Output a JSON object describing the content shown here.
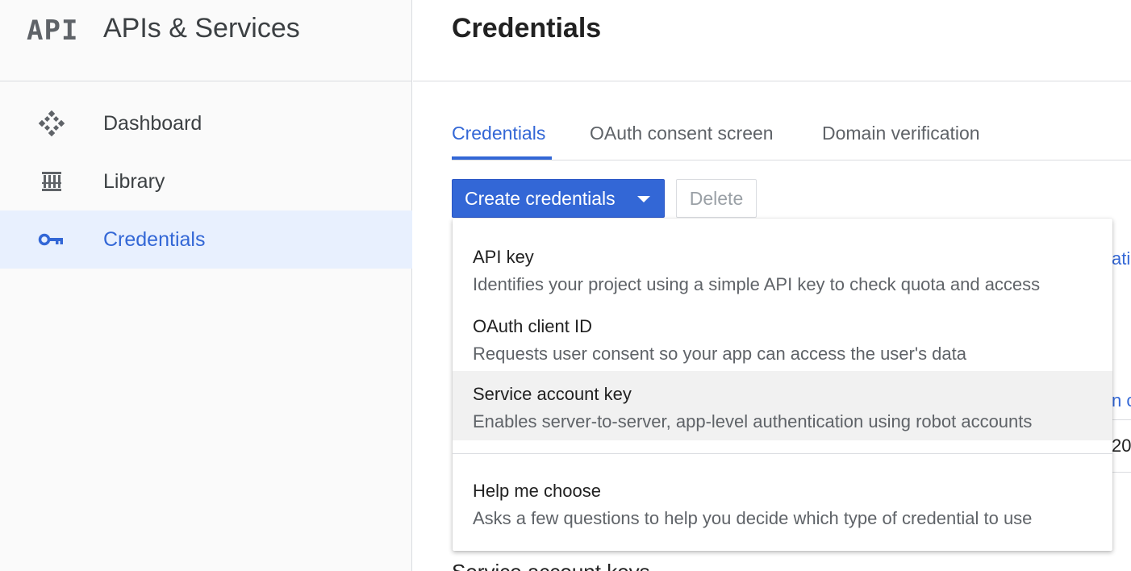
{
  "sidebar": {
    "logo_text": "API",
    "product_title": "APIs & Services",
    "items": [
      {
        "label": "Dashboard",
        "icon": "dashboard-diamond-icon"
      },
      {
        "label": "Library",
        "icon": "library-icon"
      },
      {
        "label": "Credentials",
        "icon": "key-icon",
        "active": true
      }
    ]
  },
  "main": {
    "page_title": "Credentials",
    "tabs": [
      {
        "label": "Credentials",
        "active": true
      },
      {
        "label": "OAuth consent screen"
      },
      {
        "label": "Domain verification"
      }
    ],
    "create_button_label": "Create credentials",
    "delete_button_label": "Delete",
    "background_fragments": {
      "frag1": "atio",
      "frag2": "n c",
      "frag3": "20",
      "heading": "Service account keys"
    }
  },
  "menu": {
    "items": [
      {
        "title": "API key",
        "description": "Identifies your project using a simple API key to check quota and access"
      },
      {
        "title": "OAuth client ID",
        "description": "Requests user consent so your app can access the user's data"
      },
      {
        "title": "Service account key",
        "description": "Enables server-to-server, app-level authentication using robot accounts",
        "highlighted": true
      },
      {
        "title": "Help me choose",
        "description": "Asks a few questions to help you decide which type of credential to use"
      }
    ]
  },
  "colors": {
    "accent": "#3367d6",
    "sidebar_bg": "#fafafa",
    "active_bg": "#e8f0fe",
    "highlight_bg": "#f1f1f1"
  }
}
